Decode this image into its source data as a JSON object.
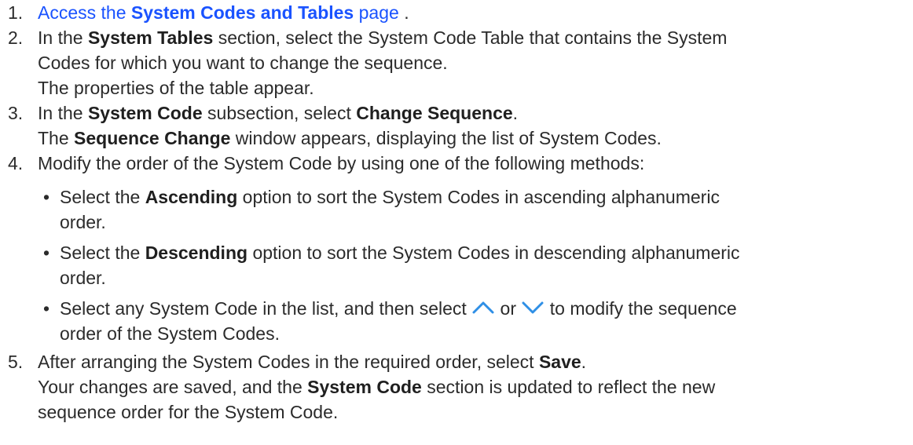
{
  "colors": {
    "link": "#1a53ff",
    "text": "#2b2b2b",
    "icon": "#2f8fe6"
  },
  "icons": {
    "up": "chevron-up-icon",
    "down": "chevron-down-icon"
  },
  "steps": [
    {
      "number": "1.",
      "link_pre": "Access the ",
      "link_bold": "System Codes and Tables",
      "link_post": " page"
    },
    {
      "number": "2.",
      "pre": "In the ",
      "bold": "System Tables",
      "post1": " section, select the System Code Table that contains the System",
      "line2": "Codes for which you want to change the sequence.",
      "result": "The properties of the table appear."
    },
    {
      "number": "3.",
      "pre": "In the ",
      "bold1": "System Code",
      "mid": " subsection, select ",
      "bold2": "Change Sequence",
      "end": ".",
      "result_pre": "The ",
      "result_bold": "Sequence Change",
      "result_post": " window appears, displaying the list of System Codes."
    },
    {
      "number": "4.",
      "text": "Modify the order of the System Code by using one of the following methods:",
      "methods": [
        {
          "bullet": "•",
          "pre": "Select the ",
          "bold": "Ascending",
          "post": " option to sort the System Codes in ascending alphanumeric",
          "line2": "order."
        },
        {
          "bullet": "•",
          "pre": "Select the ",
          "bold": "Descending",
          "post": " option to sort the System Codes in descending alphanumeric",
          "line2": "order."
        },
        {
          "bullet": "•",
          "pre": "Select any System Code in the list, and then select ",
          "mid": " or ",
          "post": " to modify the sequence",
          "line2": "order of the System Codes."
        }
      ]
    },
    {
      "number": "5.",
      "pre": "After arranging the System Codes in the required order, select ",
      "bold": "Save",
      "end": ".",
      "result1_pre": "Your changes are saved, and the ",
      "result1_bold": "System Code",
      "result1_post": " section is updated to reflect the new",
      "result2": "sequence order for the System Code."
    }
  ]
}
